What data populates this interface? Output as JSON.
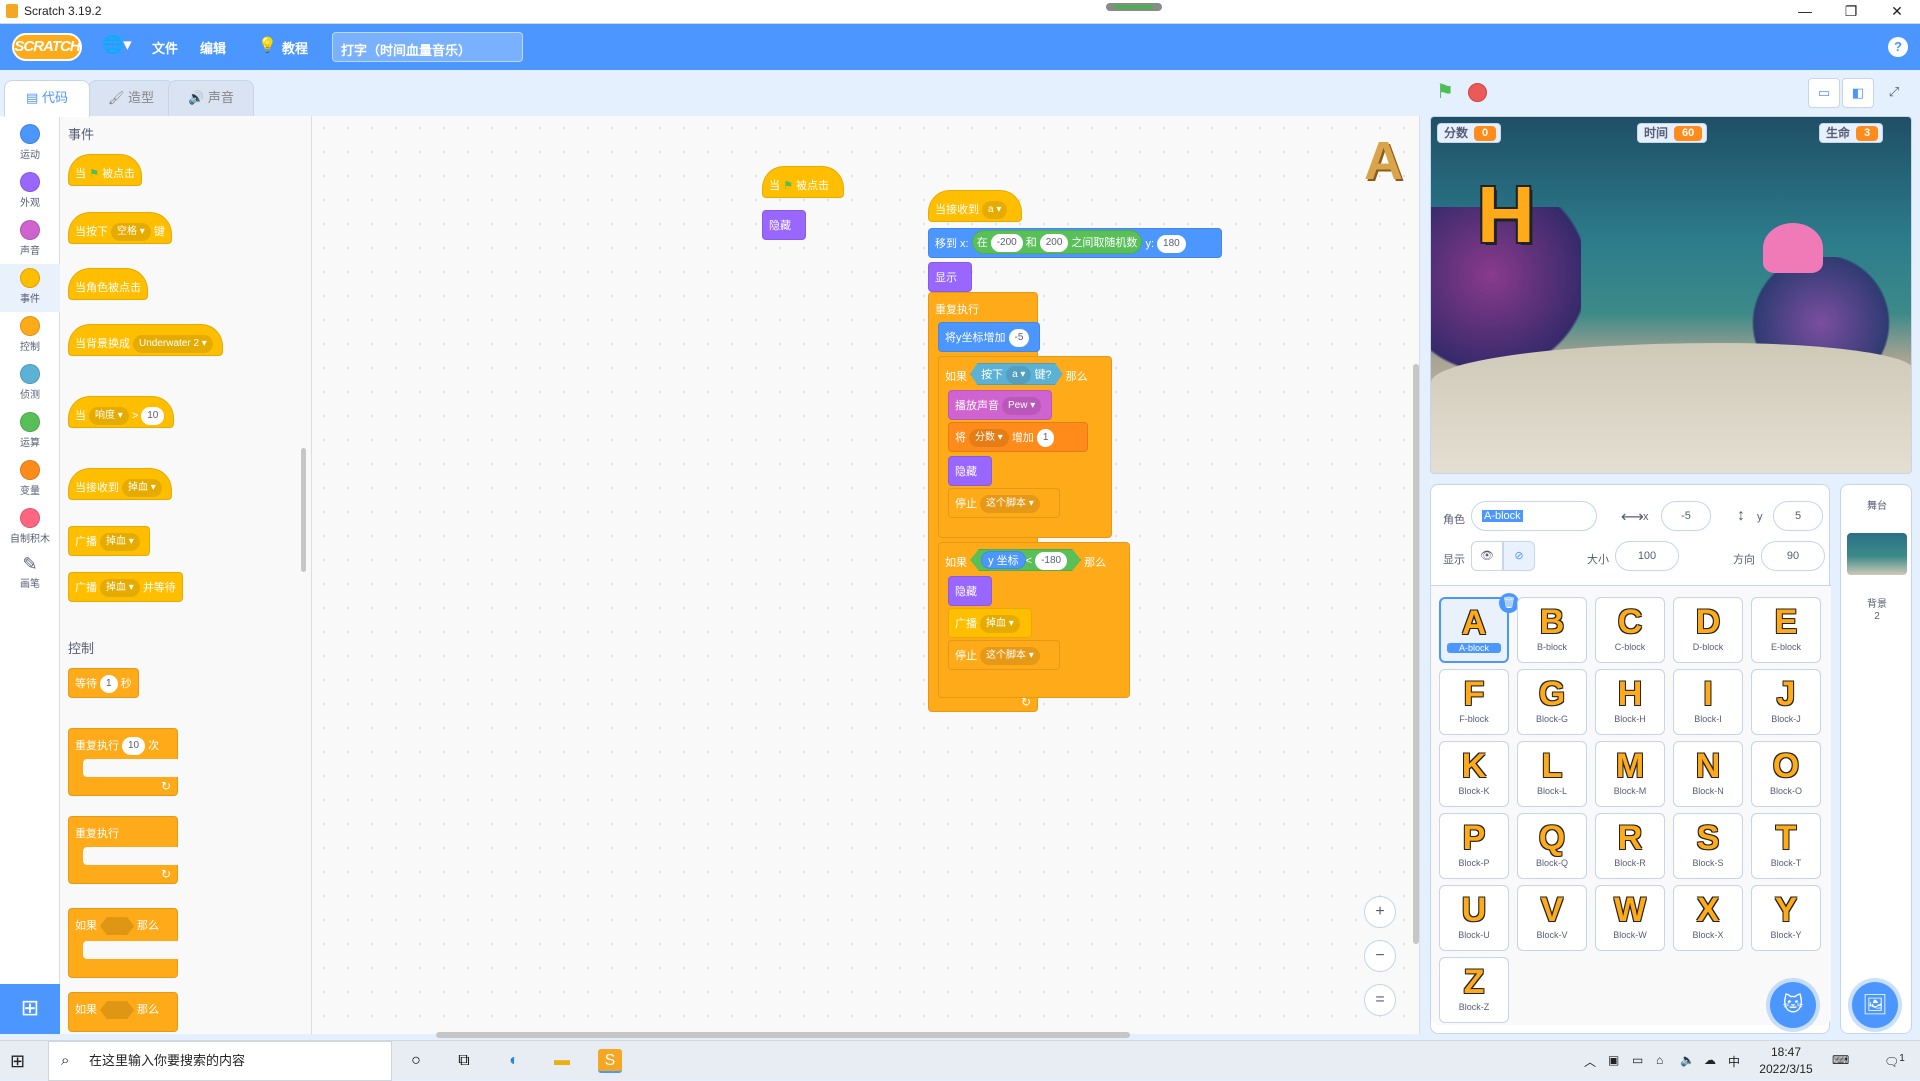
{
  "window": {
    "title": "Scratch 3.19.2",
    "min": "—",
    "max": "❐",
    "close": "✕"
  },
  "menubar": {
    "logo": "SCRATCH",
    "file": "文件",
    "edit": "编辑",
    "tutorials": "教程",
    "project_title": "打字（时间血量音乐）",
    "help": "?"
  },
  "tabs": {
    "code": "代码",
    "costumes": "造型",
    "sounds": "声音"
  },
  "categories": [
    {
      "label": "运动",
      "color": "#4c97ff"
    },
    {
      "label": "外观",
      "color": "#9966ff"
    },
    {
      "label": "声音",
      "color": "#cf63cf"
    },
    {
      "label": "事件",
      "color": "#ffbf00"
    },
    {
      "label": "控制",
      "color": "#ffab19"
    },
    {
      "label": "侦测",
      "color": "#5cb1d6"
    },
    {
      "label": "运算",
      "color": "#59c059"
    },
    {
      "label": "变量",
      "color": "#ff8c1a"
    },
    {
      "label": "自制积木",
      "color": "#ff6680"
    },
    {
      "label": "画笔",
      "color": "#0fbd8c"
    }
  ],
  "palette": {
    "events_head": "事件",
    "when_flag": "当",
    "when_flag_tail": "被点击",
    "when_key": "当按下",
    "key_space": "空格",
    "key_tail": "键",
    "when_sprite_clicked": "当角色被点击",
    "when_backdrop": "当背景换成",
    "backdrop_name": "Underwater 2",
    "when_loud": "当",
    "loudness": "响度",
    "gt": ">",
    "loud_val": "10",
    "when_receive": "当接收到",
    "msg": "掉血",
    "broadcast": "广播",
    "broadcast_wait": "广播",
    "and_wait": "并等待",
    "control_head": "控制",
    "wait": "等待",
    "wait_val": "1",
    "sec": "秒",
    "repeat": "重复执行",
    "repeat_val": "10",
    "times": "次",
    "forever": "重复执行",
    "if": "如果",
    "then": "那么"
  },
  "script1": {
    "hat_pre": "当",
    "hat_post": "被点击",
    "hide": "隐藏"
  },
  "script2": {
    "hat": "当接收到",
    "hat_msg": "a",
    "goto": "移到 x:",
    "rand": "在",
    "rand_from": "-200",
    "and": "和",
    "rand_to": "200",
    "rand_tail": "之间取随机数",
    "y_lbl": "y:",
    "y_val": "180",
    "show": "显示",
    "forever": "重复执行",
    "change_y": "将y坐标增加",
    "change_val": "-5",
    "if1": "如果",
    "key_pressed": "按下",
    "key": "a",
    "key_tail": "键?",
    "then1": "那么",
    "play": "播放声音",
    "sound": "Pew",
    "set": "将",
    "var": "分数",
    "inc": "增加",
    "inc_val": "1",
    "hide1": "隐藏",
    "stop1": "停止",
    "stop_opt1": "这个脚本",
    "if2": "如果",
    "ycoord": "y 坐标",
    "lt": "<",
    "lt_val": "-180",
    "then2": "那么",
    "hide2": "隐藏",
    "bcast": "广播",
    "bcast_msg": "掉血",
    "stop2": "停止",
    "stop_opt2": "这个脚本"
  },
  "workspace": {
    "sprite_letter": "A",
    "zoom_in": "+",
    "zoom_out": "−",
    "zoom_reset": "="
  },
  "stage_monitors": {
    "score_label": "分数",
    "score": "0",
    "time_label": "时间",
    "time": "60",
    "life_label": "生命",
    "life": "3"
  },
  "stage_letter": "H",
  "sprite_info": {
    "sprite_label": "角色",
    "sprite_name": "A-block",
    "x_label": "x",
    "x": "-5",
    "y_label": "y",
    "y": "5",
    "show_label": "显示",
    "size_label": "大小",
    "size": "100",
    "dir_label": "方向",
    "dir": "90"
  },
  "sprites": [
    {
      "glyph": "A",
      "name": "A-block"
    },
    {
      "glyph": "B",
      "name": "B-block"
    },
    {
      "glyph": "C",
      "name": "C-block"
    },
    {
      "glyph": "D",
      "name": "D-block"
    },
    {
      "glyph": "E",
      "name": "E-block"
    },
    {
      "glyph": "F",
      "name": "F-block"
    },
    {
      "glyph": "G",
      "name": "Block-G"
    },
    {
      "glyph": "H",
      "name": "Block-H"
    },
    {
      "glyph": "I",
      "name": "Block-I"
    },
    {
      "glyph": "J",
      "name": "Block-J"
    },
    {
      "glyph": "K",
      "name": "Block-K"
    },
    {
      "glyph": "L",
      "name": "Block-L"
    },
    {
      "glyph": "M",
      "name": "Block-M"
    },
    {
      "glyph": "N",
      "name": "Block-N"
    },
    {
      "glyph": "O",
      "name": "Block-O"
    },
    {
      "glyph": "P",
      "name": "Block-P"
    },
    {
      "glyph": "Q",
      "name": "Block-Q"
    },
    {
      "glyph": "R",
      "name": "Block-R"
    },
    {
      "glyph": "S",
      "name": "Block-S"
    },
    {
      "glyph": "T",
      "name": "Block-T"
    },
    {
      "glyph": "U",
      "name": "Block-U"
    },
    {
      "glyph": "V",
      "name": "Block-V"
    },
    {
      "glyph": "W",
      "name": "Block-W"
    },
    {
      "glyph": "X",
      "name": "Block-X"
    },
    {
      "glyph": "Y",
      "name": "Block-Y"
    },
    {
      "glyph": "Z",
      "name": "Block-Z"
    }
  ],
  "stage_panel": {
    "title": "舞台",
    "backdrop_label": "背景",
    "backdrop_count": "2"
  },
  "taskbar": {
    "search_placeholder": "在这里输入你要搜索的内容",
    "time": "18:47",
    "date": "2022/3/15",
    "ime": "中",
    "notif": "1"
  }
}
